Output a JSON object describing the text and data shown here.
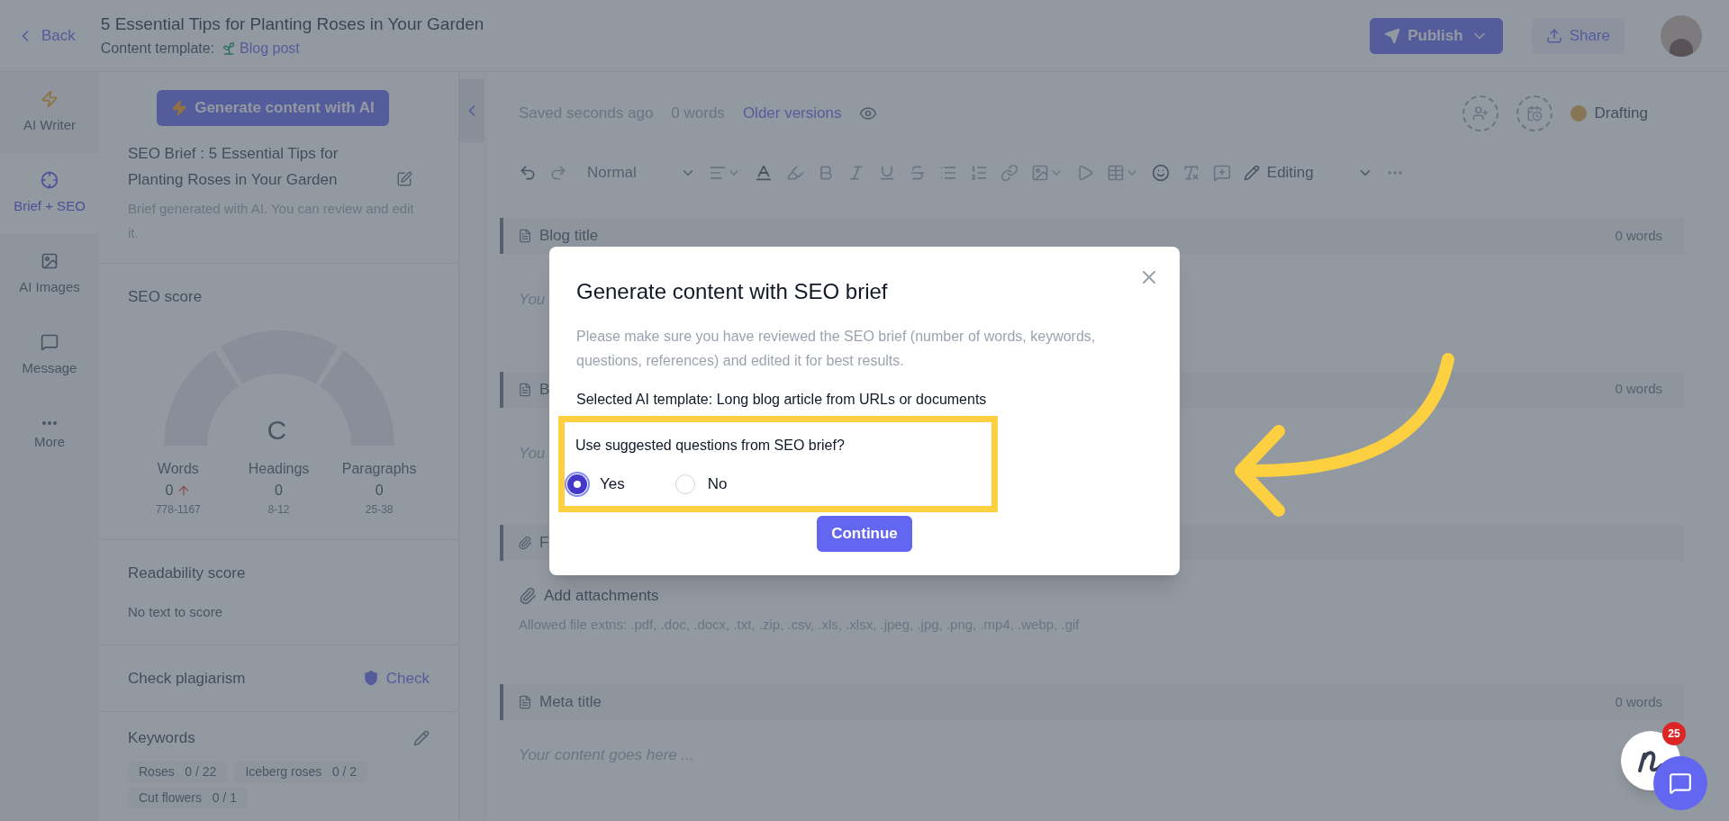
{
  "header": {
    "back": "Back",
    "title": "5 Essential Tips for Planting Roses in Your Garden",
    "template_label": "Content template:",
    "template": "Blog post",
    "publish": "Publish",
    "share": "Share"
  },
  "rail": [
    {
      "kind": "writer",
      "label": "AI Writer",
      "selected": false
    },
    {
      "kind": "brief",
      "label": "Brief + SEO",
      "selected": true
    },
    {
      "kind": "images",
      "label": "AI Images",
      "selected": false
    },
    {
      "kind": "message",
      "label": "Message",
      "selected": false
    },
    {
      "kind": "more",
      "label": "More",
      "selected": false
    }
  ],
  "panel": {
    "generate_button": "Generate content with AI",
    "brief_title": "SEO Brief : 5 Essential Tips for Planting Roses in Your Garden",
    "brief_note": "Brief generated with AI. You can review and edit it.",
    "seo_score": {
      "title": "SEO score",
      "grade": "C",
      "metrics": [
        {
          "label": "Words",
          "value": "0",
          "range": "778-1167",
          "rising": true
        },
        {
          "label": "Headings",
          "value": "0",
          "range": "8-12",
          "rising": false
        },
        {
          "label": "Paragraphs",
          "value": "0",
          "range": "25-38",
          "rising": false
        }
      ]
    },
    "readability": {
      "title": "Readability score",
      "note": "No text to score"
    },
    "plagiarism": {
      "title": "Check plagiarism",
      "action": "Check"
    },
    "keywords": {
      "title": "Keywords",
      "chips": [
        {
          "label": "Roses",
          "count": "0 / 22"
        },
        {
          "label": "Iceberg roses",
          "count": "0 / 2"
        },
        {
          "label": "Cut flowers",
          "count": "0 / 1"
        }
      ]
    }
  },
  "editor": {
    "saved": "Saved seconds ago",
    "words": "0 words",
    "older_versions": "Older versions",
    "status": "Drafting",
    "style": "Normal",
    "mode": "Editing",
    "sections": [
      {
        "kind": "text",
        "title": "Blog title",
        "count": "0 words",
        "placeholder": "You"
      },
      {
        "kind": "text",
        "title": "B",
        "count": "0 words",
        "placeholder": "You"
      },
      {
        "kind": "attach",
        "title": "F"
      }
    ],
    "attachments": {
      "label": "Add attachments",
      "note": "Allowed file extns: .pdf, .doc, .docx, .txt, .zip, .csv, .xls, .xlsx, .jpeg, .jpg, .png, .mp4, .webp, .gif"
    },
    "meta": {
      "title": "Meta title",
      "count": "0 words",
      "placeholder": "Your content goes here ..."
    }
  },
  "notification_count": "25",
  "modal": {
    "title": "Generate content with SEO brief",
    "description": "Please make sure you have reviewed the SEO brief (number of words, keywords, questions, references) and edited it for best results.",
    "template_line": "Selected AI template: Long blog article from URLs or documents",
    "question": "Use suggested questions from SEO brief?",
    "options": [
      {
        "label": "Yes",
        "selected": true
      },
      {
        "label": "No",
        "selected": false
      }
    ],
    "continue": "Continue"
  }
}
